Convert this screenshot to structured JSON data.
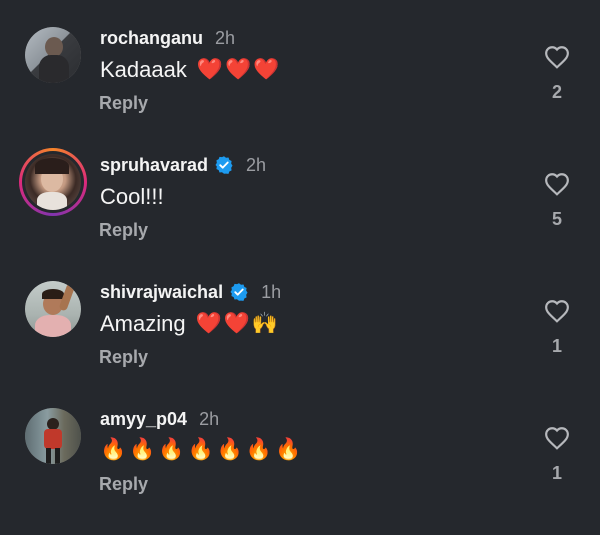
{
  "comments": [
    {
      "username": "rochanganu",
      "verified": false,
      "time": "2h",
      "text": "Kadaaak",
      "emojis": [
        "❤️",
        "❤️",
        "❤️"
      ],
      "reply_label": "Reply",
      "likes": "2",
      "avatar_colors": [
        "#9aa4ad",
        "#2d2f33"
      ]
    },
    {
      "username": "spruhavarad",
      "verified": true,
      "time": "2h",
      "text": "Cool!!!",
      "emojis": [],
      "reply_label": "Reply",
      "likes": "5",
      "avatar_colors": [
        "#c9a48e",
        "#3a2a26"
      ]
    },
    {
      "username": "shivrajwaichal",
      "verified": true,
      "time": "1h",
      "text": "Amazing",
      "emojis": [
        "❤️",
        "❤️",
        "🙌"
      ],
      "reply_label": "Reply",
      "likes": "1",
      "avatar_colors": [
        "#b8c0bd",
        "#d9a6a6"
      ]
    },
    {
      "username": "amyy_p04",
      "verified": false,
      "time": "2h",
      "text": "",
      "emojis": [
        "🔥",
        "🔥",
        "🔥",
        "🔥",
        "🔥",
        "🔥",
        "🔥"
      ],
      "reply_label": "Reply",
      "likes": "1",
      "avatar_colors": [
        "#7d8f95",
        "#c0392b"
      ]
    }
  ],
  "colors": {
    "background": "#25282d",
    "verified_blue": "#1d9bf0",
    "muted_text": "#a7a9ad"
  }
}
